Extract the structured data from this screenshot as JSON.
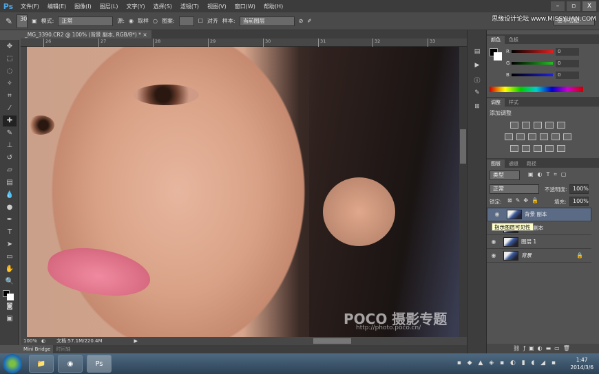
{
  "app": {
    "logo": "Ps",
    "menus": [
      "文件(F)",
      "编辑(E)",
      "图像(I)",
      "图层(L)",
      "文字(Y)",
      "选择(S)",
      "滤镜(T)",
      "视图(V)",
      "窗口(W)",
      "帮助(H)"
    ],
    "window_controls": [
      "–",
      "▫",
      "X"
    ],
    "watermark_top": "思缘设计论坛 www.MISSYUAN.COM"
  },
  "options": {
    "brush_size": "30",
    "mode_label": "模式:",
    "mode_value": "正常",
    "source_label": "源:",
    "sampled_label": "取样",
    "pattern_label": "图案:",
    "aligned_label": "对齐",
    "sample_label": "样本:",
    "sample_value": "当前图层",
    "workspace": "基本功能"
  },
  "document": {
    "tab_title": "_MG_3390.CR2 @ 100% (背景 副本, RGB/8*) *",
    "close": "×",
    "ruler": [
      "26",
      "27",
      "28",
      "29",
      "30",
      "31",
      "32",
      "33"
    ],
    "watermark": "POCO 摄影专题",
    "watermark_url": "http://photo.poco.cn/"
  },
  "status": {
    "zoom": "100%",
    "doc_info": "文档:57.1M/220.4M"
  },
  "bottom_tabs": [
    "Mini Bridge",
    "时间轴"
  ],
  "color_panel": {
    "tabs": [
      "颜色",
      "色板"
    ],
    "channels": [
      {
        "name": "R",
        "value": "0",
        "color": "#e02020"
      },
      {
        "name": "G",
        "value": "0",
        "color": "#20c020"
      },
      {
        "name": "B",
        "value": "0",
        "color": "#2020e0"
      }
    ]
  },
  "adjust_panel": {
    "tabs": [
      "调整",
      "样式"
    ],
    "title": "添加调整"
  },
  "layers_panel": {
    "tabs": [
      "图层",
      "通道",
      "路径"
    ],
    "filter": "类型",
    "blend": "正常",
    "opacity_label": "不透明度:",
    "opacity": "100%",
    "lock_label": "锁定:",
    "fill_label": "填充:",
    "fill": "100%",
    "layers": [
      {
        "name": "背景 副本",
        "selected": true
      },
      {
        "name": "背景 副本",
        "selected": false
      },
      {
        "name": "图层 1",
        "selected": false
      },
      {
        "name": "背景",
        "selected": false,
        "locked": true
      }
    ],
    "tooltip": "指示图层可见性",
    "footer_icons": [
      "link",
      "fx",
      "mask",
      "adjustment",
      "folder",
      "new",
      "trash"
    ]
  },
  "taskbar": {
    "apps": [
      "explorer",
      "chrome",
      "Ps"
    ],
    "time": "1:47",
    "date": "2014/3/6"
  }
}
